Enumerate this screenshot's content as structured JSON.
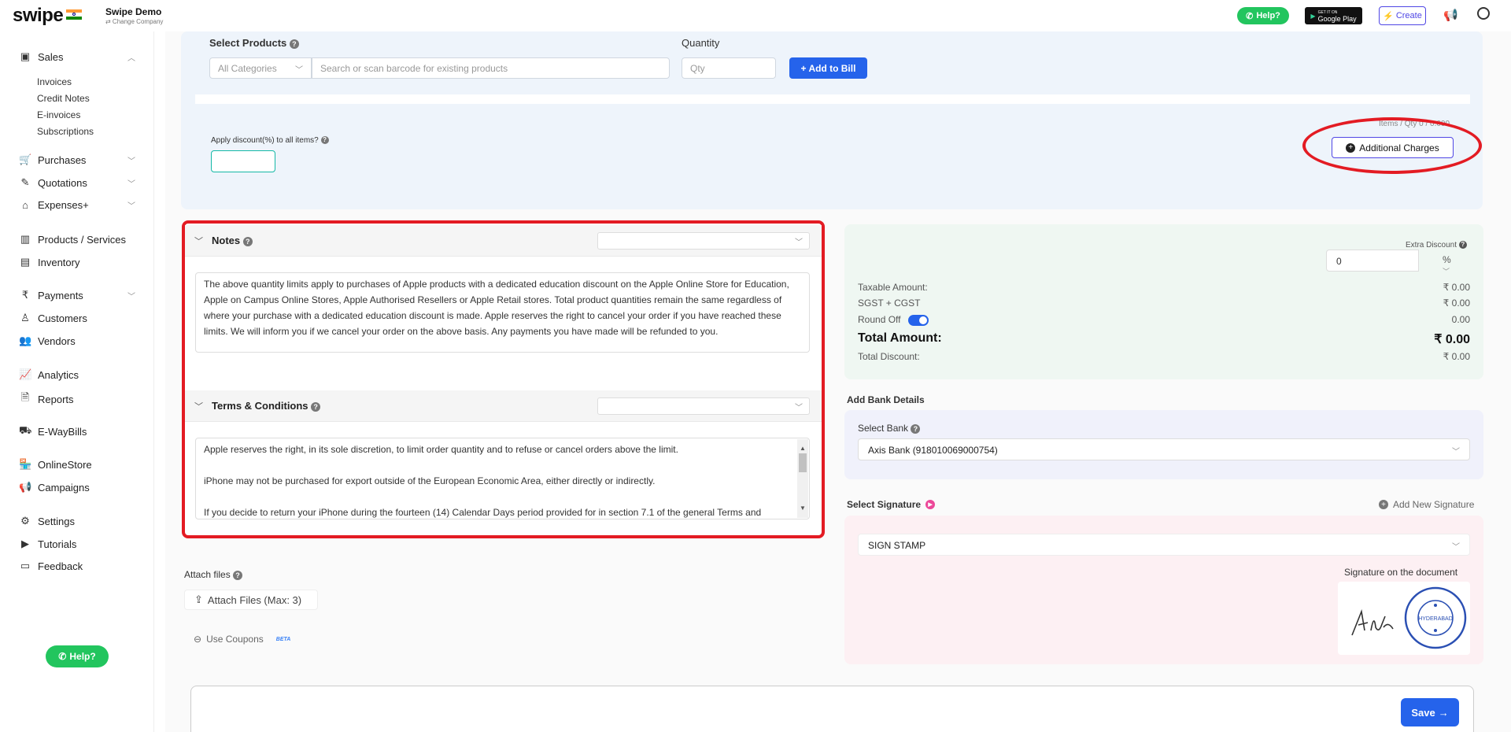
{
  "topbar": {
    "logo": "swipe",
    "company_name": "Swipe Demo",
    "company_sub": "⇄ Change Company",
    "help_label": "Help?",
    "gplay_small": "GET IT ON",
    "gplay_label": "Google Play",
    "create_label": "Create"
  },
  "sidebar": {
    "sales": "Sales",
    "invoices": "Invoices",
    "credit_notes": "Credit Notes",
    "einvoices": "E-invoices",
    "subscriptions": "Subscriptions",
    "purchases": "Purchases",
    "quotations": "Quotations",
    "expenses": "Expenses+",
    "products": "Products / Services",
    "inventory": "Inventory",
    "payments": "Payments",
    "customers": "Customers",
    "vendors": "Vendors",
    "analytics": "Analytics",
    "reports": "Reports",
    "ewaybills": "E-WayBills",
    "onlinestore": "OnlineStore",
    "campaigns": "Campaigns",
    "settings": "Settings",
    "tutorials": "Tutorials",
    "feedback": "Feedback",
    "help_label": "Help?"
  },
  "products": {
    "select_label": "Select Products",
    "quantity_label": "Quantity",
    "category_placeholder": "All Categories",
    "search_placeholder": "Search or scan barcode for existing products",
    "qty_placeholder": "Qty",
    "add_to_bill": "+ Add to Bill",
    "items_qty": "Items / Qty 0 / 0.000",
    "discount_label": "Apply discount(%) to all items?",
    "additional_charges": "Additional Charges"
  },
  "notes": {
    "title": "Notes",
    "text": "The above quantity limits apply to purchases of Apple products with a dedicated education discount on the Apple Online Store for Education, Apple on Campus Online Stores, Apple Authorised Resellers or Apple Retail stores. Total product quantities remain the same regardless of where your purchase with a dedicated education discount is made. Apple reserves the right to cancel your order if you have reached these limits. We will inform you if we cancel your order on the above basis. Any payments you have made will be refunded to you."
  },
  "terms": {
    "title": "Terms & Conditions",
    "line1": "Apple reserves the right, in its sole discretion, to limit order quantity and to refuse or cancel orders above the limit.",
    "line2": "iPhone may not be purchased for export outside of the European Economic Area, either directly or indirectly.",
    "line3": "If you decide to return your iPhone during the fourteen (14) Calendar Days period provided for in section 7.1 of the general Terms and"
  },
  "attach": {
    "label": "Attach files",
    "button": "Attach Files (Max: 3)",
    "coupons": "Use Coupons",
    "beta": "BETA"
  },
  "totals": {
    "extra_discount_label": "Extra Discount",
    "extra_discount_value": "0",
    "extra_discount_unit": "%",
    "taxable_label": "Taxable Amount:",
    "taxable_value": "₹ 0.00",
    "gst_label": "SGST + CGST",
    "gst_value": "₹ 0.00",
    "roundoff_label": "Round Off",
    "roundoff_value": "0.00",
    "total_label": "Total Amount:",
    "total_value": "₹ 0.00",
    "total_discount_label": "Total Discount:",
    "total_discount_value": "₹ 0.00"
  },
  "bank": {
    "section_label": "Add Bank Details",
    "select_label": "Select Bank",
    "selected": "Axis Bank (918010069000754)"
  },
  "signature": {
    "select_label": "Select Signature",
    "add_new": "Add New Signature",
    "selected": "SIGN STAMP",
    "doc_label": "Signature on the document",
    "stamp_city": "HYDERABAD"
  },
  "footer": {
    "save_label": "Save"
  }
}
